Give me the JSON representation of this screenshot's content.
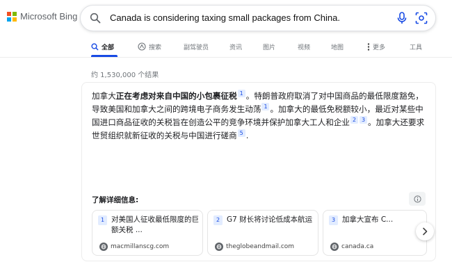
{
  "logo": {
    "text": "Microsoft Bing"
  },
  "search": {
    "query": "Canada is considering taxing small packages from China."
  },
  "tabs": [
    {
      "label": "全部",
      "icon": "search-icon"
    },
    {
      "label": "搜索",
      "icon": "copilot-icon"
    },
    {
      "label": "副驾驶员"
    },
    {
      "label": "资讯"
    },
    {
      "label": "图片"
    },
    {
      "label": "视频"
    },
    {
      "label": "地图"
    },
    {
      "label": "更多",
      "icon": "more-vertical-icon"
    },
    {
      "label": "工具"
    }
  ],
  "result_count": "约 1,530,000 个结果",
  "answer": {
    "p1": "加拿大",
    "bold": "正在考虑对来自中国的小包裹征税",
    "c1": "1",
    "p2": "。特朗普政府取消了对中国商品的最低限度豁免，导致美国和加拿大之间的跨境电子商务发生动荡",
    "c2": "1",
    "p3": "。加拿大的最低免税额较小，最近对某些中国进口商品征收的关税旨在创造公平的竞争环境并保护加拿大工人和企业",
    "c3": "2",
    "c4": "3",
    "p4": "。加拿大还要求世贸组织就新征收的关税与中国进行磋商",
    "c5": "5",
    "p5": "."
  },
  "learn_more": "了解详细信息:",
  "sources": [
    {
      "num": "1",
      "title": "对美国人征收最低限度的巨额关税 ...",
      "domain": "macmillanscg.com"
    },
    {
      "num": "2",
      "title": "G7 财长将讨论低成本航运",
      "domain": "theglobeandmail.com"
    },
    {
      "num": "3",
      "title": "加拿大宣布 C...",
      "domain": "canada.ca"
    }
  ],
  "colors": {
    "accent": "#174ae4",
    "ms_red": "#f25022",
    "ms_green": "#7fba00",
    "ms_blue": "#00a4ef",
    "ms_yellow": "#ffb900"
  }
}
